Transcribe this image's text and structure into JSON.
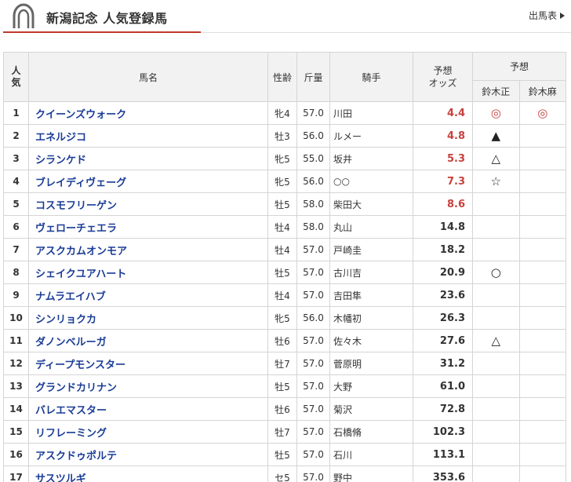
{
  "header": {
    "title": "新潟記念 人気登録馬",
    "entries_link": "出馬表"
  },
  "colors": {
    "accent": "#c0392b",
    "horse_name": "#1a3c96",
    "favorite_odds": "#c8423c"
  },
  "icons": {
    "logo": "horseshoe-icon",
    "link_arrow": "triangle-right-icon"
  },
  "table": {
    "headers": {
      "rank_top": "人",
      "rank_bottom": "気",
      "name": "馬名",
      "sex_age": "性齢",
      "weight": "斤量",
      "jockey": "騎手",
      "odds_top": "予想",
      "odds_bottom": "オッズ",
      "prediction": "予想",
      "predictor1": "鈴木正",
      "predictor2": "鈴木麻"
    },
    "rows": [
      {
        "rank": "1",
        "name": "クイーンズウォーク",
        "sex_age": "牝4",
        "weight": "57.0",
        "jockey": "川田",
        "odds": "4.4",
        "hot": true,
        "mark1": "◎",
        "mark2": "◎"
      },
      {
        "rank": "2",
        "name": "エネルジコ",
        "sex_age": "牡3",
        "weight": "56.0",
        "jockey": "ルメー",
        "odds": "4.8",
        "hot": true,
        "mark1": "▲",
        "mark2": ""
      },
      {
        "rank": "3",
        "name": "シランケド",
        "sex_age": "牝5",
        "weight": "55.0",
        "jockey": "坂井",
        "odds": "5.3",
        "hot": true,
        "mark1": "△",
        "mark2": ""
      },
      {
        "rank": "4",
        "name": "ブレイディヴェーグ",
        "sex_age": "牝5",
        "weight": "56.0",
        "jockey": "○○",
        "odds": "7.3",
        "hot": true,
        "mark1": "☆",
        "mark2": ""
      },
      {
        "rank": "5",
        "name": "コスモフリーゲン",
        "sex_age": "牡5",
        "weight": "58.0",
        "jockey": "柴田大",
        "odds": "8.6",
        "hot": true,
        "mark1": "",
        "mark2": ""
      },
      {
        "rank": "6",
        "name": "ヴェローチェエラ",
        "sex_age": "牡4",
        "weight": "58.0",
        "jockey": "丸山",
        "odds": "14.8",
        "hot": false,
        "mark1": "",
        "mark2": ""
      },
      {
        "rank": "7",
        "name": "アスクカムオンモア",
        "sex_age": "牡4",
        "weight": "57.0",
        "jockey": "戸崎圭",
        "odds": "18.2",
        "hot": false,
        "mark1": "",
        "mark2": ""
      },
      {
        "rank": "8",
        "name": "シェイクユアハート",
        "sex_age": "牡5",
        "weight": "57.0",
        "jockey": "古川吉",
        "odds": "20.9",
        "hot": false,
        "mark1": "○",
        "mark2": ""
      },
      {
        "rank": "9",
        "name": "ナムラエイハブ",
        "sex_age": "牡4",
        "weight": "57.0",
        "jockey": "吉田隼",
        "odds": "23.6",
        "hot": false,
        "mark1": "",
        "mark2": ""
      },
      {
        "rank": "10",
        "name": "シンリョクカ",
        "sex_age": "牝5",
        "weight": "56.0",
        "jockey": "木幡初",
        "odds": "26.3",
        "hot": false,
        "mark1": "",
        "mark2": ""
      },
      {
        "rank": "11",
        "name": "ダノンベルーガ",
        "sex_age": "牡6",
        "weight": "57.0",
        "jockey": "佐々木",
        "odds": "27.6",
        "hot": false,
        "mark1": "△",
        "mark2": ""
      },
      {
        "rank": "12",
        "name": "ディープモンスター",
        "sex_age": "牡7",
        "weight": "57.0",
        "jockey": "菅原明",
        "odds": "31.2",
        "hot": false,
        "mark1": "",
        "mark2": ""
      },
      {
        "rank": "13",
        "name": "グランドカリナン",
        "sex_age": "牡5",
        "weight": "57.0",
        "jockey": "大野",
        "odds": "61.0",
        "hot": false,
        "mark1": "",
        "mark2": ""
      },
      {
        "rank": "14",
        "name": "バレエマスター",
        "sex_age": "牡6",
        "weight": "57.0",
        "jockey": "菊沢",
        "odds": "72.8",
        "hot": false,
        "mark1": "",
        "mark2": ""
      },
      {
        "rank": "15",
        "name": "リフレーミング",
        "sex_age": "牡7",
        "weight": "57.0",
        "jockey": "石橋脩",
        "odds": "102.3",
        "hot": false,
        "mark1": "",
        "mark2": ""
      },
      {
        "rank": "16",
        "name": "アスクドゥポルテ",
        "sex_age": "牡5",
        "weight": "57.0",
        "jockey": "石川",
        "odds": "113.1",
        "hot": false,
        "mark1": "",
        "mark2": ""
      },
      {
        "rank": "17",
        "name": "サスツルギ",
        "sex_age": "セ5",
        "weight": "57.0",
        "jockey": "野中",
        "odds": "353.6",
        "hot": false,
        "mark1": "",
        "mark2": ""
      }
    ]
  }
}
